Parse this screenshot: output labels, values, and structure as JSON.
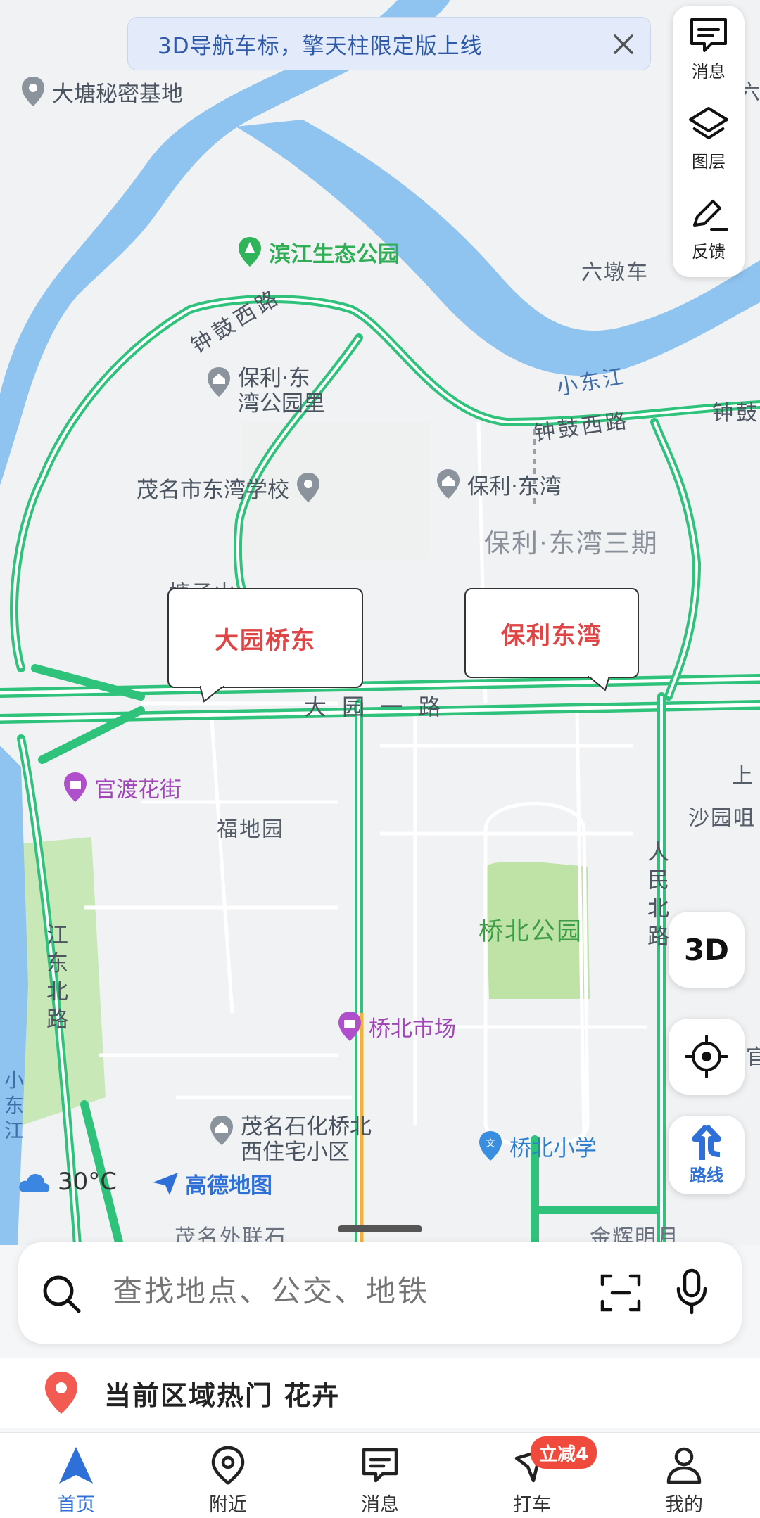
{
  "banner": {
    "text": "3D导航车标，擎天柱限定版上线"
  },
  "tools": {
    "messages": "消息",
    "layers": "图层",
    "feedback": "反馈"
  },
  "map": {
    "places": {
      "datang": "大塘秘密基地",
      "binjiang_park": "滨江生态公园",
      "liudunche": "六墩车",
      "poly_park": "保利·东\n湾公园里",
      "school": "茂名市东湾学校",
      "poly_dongwan": "保利·东湾",
      "poly_phase3": "保利·东湾三期",
      "tangzi": "塘子山",
      "guandu": "官渡花街",
      "fudiyuan": "福地园",
      "shayuan": "沙园咀",
      "shang": "上",
      "qiaobei_park": "桥北公园",
      "qiaobei_market": "桥北市场",
      "sinopec": "茂名石化桥北\n西住宅小区",
      "qiaobei_school": "桥北小学",
      "waixian": "茂名外联石",
      "jinhui": "金辉明月",
      "liu": "六",
      "gong": "官"
    },
    "roads": {
      "zhonggu_w": "钟鼓西路",
      "zhonggu_w2": "钟鼓西路",
      "zhonggu": "钟鼓",
      "dayuan1": "大 园 一 路",
      "jiangdong_n": "江东北路",
      "renmin_n": "人民北路"
    },
    "water": {
      "xiaodongjiang": "小东江",
      "xiaodongjiang_v": "小东江"
    }
  },
  "callouts": {
    "left": "大园桥东",
    "right": "保利东湾"
  },
  "controls": {
    "three_d": "3D",
    "route": "路线"
  },
  "weather": {
    "temp": "30°C"
  },
  "brand": {
    "name": "高德地图"
  },
  "search": {
    "placeholder": "查找地点、公交、地铁"
  },
  "hot": {
    "text": "当前区域热门 花卉"
  },
  "tabs": {
    "home": "首页",
    "nearby": "附近",
    "messages": "消息",
    "taxi": "打车",
    "mine": "我的"
  },
  "badge": {
    "taxi": "立减4"
  },
  "colors": {
    "accent": "#2f6fd8",
    "road": "#2fc27a",
    "water": "#8fc3f0",
    "park": "#c7e6b1",
    "callout_text": "#e04545"
  }
}
